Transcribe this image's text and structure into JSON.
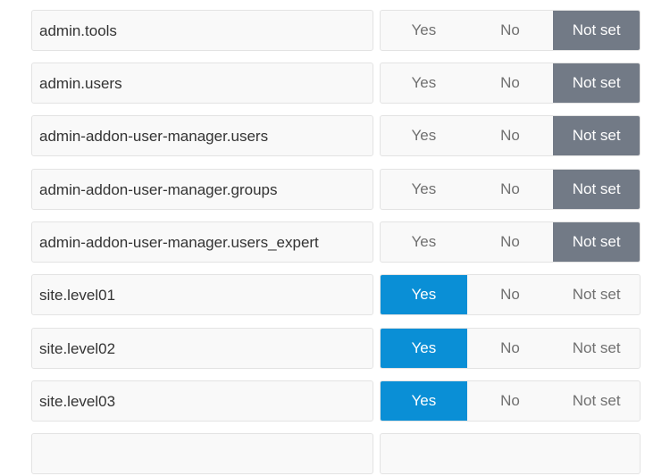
{
  "option_labels": {
    "yes": "Yes",
    "no": "No",
    "not_set": "Not set"
  },
  "colors": {
    "yes_selected": "#0a8fd6",
    "not_set_selected": "#727a86"
  },
  "permissions": [
    {
      "name": "admin.tools",
      "value": "Not set"
    },
    {
      "name": "admin.users",
      "value": "Not set"
    },
    {
      "name": "admin-addon-user-manager.users",
      "value": "Not set"
    },
    {
      "name": "admin-addon-user-manager.groups",
      "value": "Not set"
    },
    {
      "name": "admin-addon-user-manager.users_expert",
      "value": "Not set"
    },
    {
      "name": "site.level01",
      "value": "Yes"
    },
    {
      "name": "site.level02",
      "value": "Yes"
    },
    {
      "name": "site.level03",
      "value": "Yes"
    }
  ]
}
